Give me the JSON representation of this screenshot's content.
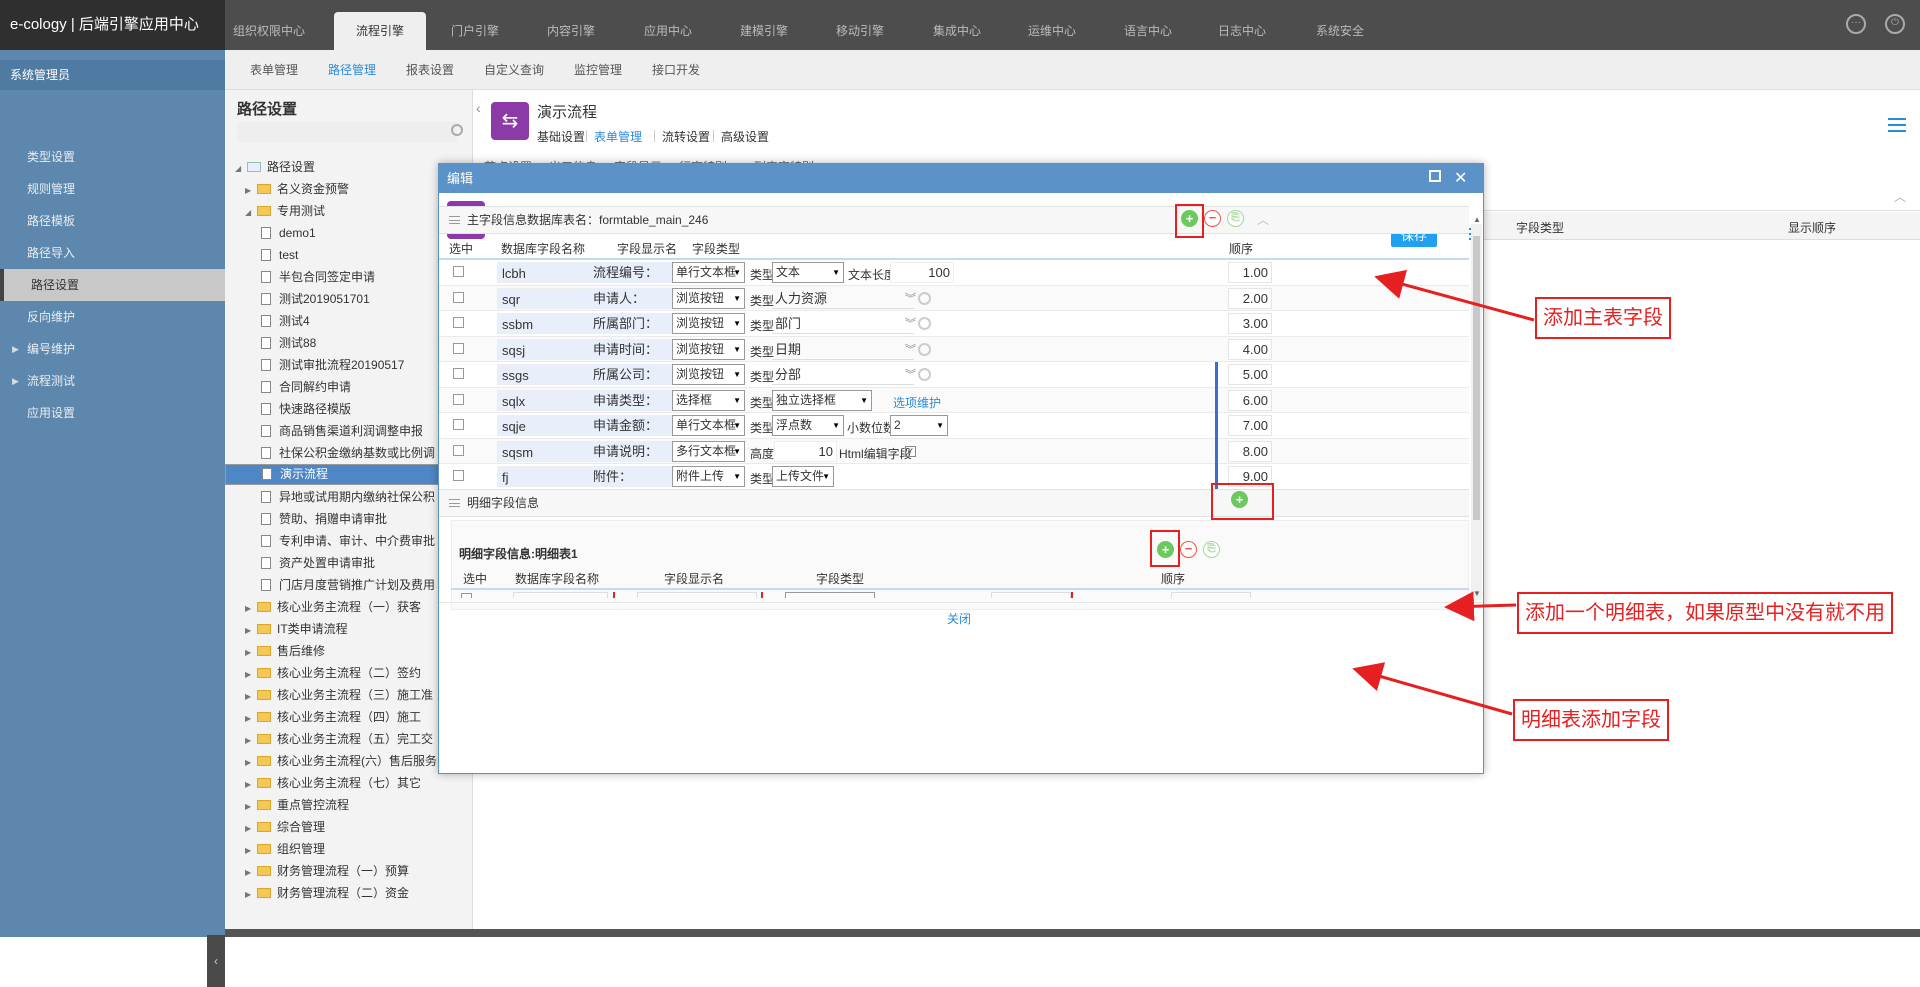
{
  "app": {
    "title": "e-cology | 后端引擎应用中心"
  },
  "topnav": {
    "tabs": [
      "组织权限中心",
      "流程引擎",
      "门户引擎",
      "内容引擎",
      "应用中心",
      "建模引擎",
      "移动引擎",
      "集成中心",
      "运维中心",
      "语言中心",
      "日志中心",
      "系统安全"
    ],
    "active": "流程引擎"
  },
  "subnav": {
    "items": [
      "表单管理",
      "路径管理",
      "报表设置",
      "自定义查询",
      "监控管理",
      "接口开发"
    ],
    "active": "路径管理"
  },
  "sidebar": {
    "header": "系统管理员",
    "items": [
      "类型设置",
      "规则管理",
      "路径模板",
      "路径导入",
      "路径设置",
      "反向维护",
      "编号维护",
      "流程测试",
      "应用设置"
    ],
    "active": "路径设置"
  },
  "tree": {
    "title": "路径设置",
    "root": "路径设置",
    "nodes": [
      {
        "label": "名义资金预警",
        "type": "folder",
        "level": 1,
        "expanded": false
      },
      {
        "label": "专用测试",
        "type": "folder",
        "level": 1,
        "expanded": true
      },
      {
        "label": "demo1",
        "type": "doc",
        "level": 2
      },
      {
        "label": "test",
        "type": "doc",
        "level": 2
      },
      {
        "label": "半包合同签定申请",
        "type": "doc",
        "level": 2
      },
      {
        "label": "测试2019051701",
        "type": "doc",
        "level": 2
      },
      {
        "label": "测试4",
        "type": "doc",
        "level": 2
      },
      {
        "label": "测试88",
        "type": "doc",
        "level": 2
      },
      {
        "label": "测试审批流程20190517",
        "type": "doc",
        "level": 2
      },
      {
        "label": "合同解约申请",
        "type": "doc",
        "level": 2
      },
      {
        "label": "快速路径模版",
        "type": "doc",
        "level": 2
      },
      {
        "label": "商品销售渠道利润调整申报",
        "type": "doc",
        "level": 2
      },
      {
        "label": "社保公积金缴纳基数或比例调",
        "type": "doc",
        "level": 2
      },
      {
        "label": "演示流程",
        "type": "doc",
        "level": 2,
        "selected": true
      },
      {
        "label": "异地或试用期内缴纳社保公积",
        "type": "doc",
        "level": 2
      },
      {
        "label": "赞助、捐赠申请审批",
        "type": "doc",
        "level": 2
      },
      {
        "label": "专利申请、审计、中介费审批",
        "type": "doc",
        "level": 2
      },
      {
        "label": "资产处置申请审批",
        "type": "doc",
        "level": 2
      },
      {
        "label": "门店月度营销推广计划及费用",
        "type": "doc",
        "level": 2
      },
      {
        "label": "核心业务主流程（一）获客",
        "type": "folder",
        "level": 1
      },
      {
        "label": "IT类申请流程",
        "type": "folder",
        "level": 1
      },
      {
        "label": "售后维修",
        "type": "folder",
        "level": 1
      },
      {
        "label": "核心业务主流程（二）签约",
        "type": "folder",
        "level": 1
      },
      {
        "label": "核心业务主流程（三）施工准",
        "type": "folder",
        "level": 1
      },
      {
        "label": "核心业务主流程（四）施工",
        "type": "folder",
        "level": 1
      },
      {
        "label": "核心业务主流程（五）完工交",
        "type": "folder",
        "level": 1
      },
      {
        "label": "核心业务主流程(六）售后服务",
        "type": "folder",
        "level": 1
      },
      {
        "label": "核心业务主流程（七）其它",
        "type": "folder",
        "level": 1
      },
      {
        "label": "重点管控流程",
        "type": "folder",
        "level": 1
      },
      {
        "label": "综合管理",
        "type": "folder",
        "level": 1
      },
      {
        "label": "组织管理",
        "type": "folder",
        "level": 1
      },
      {
        "label": "财务管理流程（一）预算",
        "type": "folder",
        "level": 1
      },
      {
        "label": "财务管理流程（二）资金",
        "type": "folder",
        "level": 1
      }
    ]
  },
  "workflow": {
    "name": "演示流程",
    "tabs": [
      "基础设置",
      "表单管理",
      "流转设置",
      "高级设置"
    ],
    "active_tab": "表单管理",
    "subtabs": [
      "节点设置",
      "出口信息",
      "字段显示",
      "行宽特别",
      "列表宽特别"
    ],
    "right_cols": [
      "字段类型",
      "显示顺序"
    ]
  },
  "modal": {
    "title": "编辑",
    "heading": "编辑",
    "save": "保存",
    "close": "关闭",
    "main_section": "主字段信息数据库表名：formtable_main_246",
    "columns": {
      "select": "选中",
      "dbname": "数据库字段名称",
      "display": "字段显示名",
      "type": "字段类型",
      "order": "顺序"
    },
    "type_label": "类型",
    "rows": [
      {
        "db": "lcbh",
        "disp": "流程编号：",
        "ftype": "单行文本框",
        "kind": "select",
        "sub": "文本",
        "extra_label": "文本长度",
        "extra_value": "100",
        "order": "1.00"
      },
      {
        "db": "sqr",
        "disp": "申请人：",
        "ftype": "浏览按钮",
        "kind": "browse",
        "sub": "人力资源",
        "order": "2.00"
      },
      {
        "db": "ssbm",
        "disp": "所属部门：",
        "ftype": "浏览按钮",
        "kind": "browse",
        "sub": "部门",
        "order": "3.00"
      },
      {
        "db": "sqsj",
        "disp": "申请时间：",
        "ftype": "浏览按钮",
        "kind": "browse",
        "sub": "日期",
        "order": "4.00"
      },
      {
        "db": "ssgs",
        "disp": "所属公司：",
        "ftype": "浏览按钮",
        "kind": "browse",
        "sub": "分部",
        "order": "5.00"
      },
      {
        "db": "sqlx",
        "disp": "申请类型：",
        "ftype": "选择框",
        "kind": "select",
        "sub": "独立选择框",
        "link": "选项维护",
        "order": "6.00"
      },
      {
        "db": "sqje",
        "disp": "申请金额：",
        "ftype": "单行文本框",
        "kind": "select",
        "sub": "浮点数",
        "extra_label": "小数位数",
        "extra_value": "2",
        "order": "7.00"
      },
      {
        "db": "sqsm",
        "disp": "申请说明：",
        "ftype": "多行文本框",
        "kind": "height",
        "height_label": "高度",
        "height_value": "10",
        "html_label": "Html编辑字段",
        "order": "8.00"
      },
      {
        "db": "fj",
        "disp": "附件：",
        "ftype": "附件上传",
        "kind": "select",
        "sub": "上传文件",
        "order": "9.00"
      }
    ],
    "detail_section": "明细字段信息",
    "detail_table": "明细字段信息:明细表1",
    "detail_columns": {
      "select": "选中",
      "dbname": "数据库字段名称",
      "display": "字段显示名",
      "type": "字段类型",
      "order": "顺序"
    }
  },
  "annotations": {
    "add_main": "添加主表字段",
    "add_detail_table": "添加一个明细表，如果原型中没有就不用",
    "add_detail_field": "明细表添加字段"
  },
  "colors": {
    "topbar": "#4d4d4d",
    "sidebar": "#5d87ad",
    "accent": "#2a8bd8",
    "modal_bar": "#5b92c7",
    "annotation": "#e62020",
    "app_icon": "#8b3aa7"
  }
}
